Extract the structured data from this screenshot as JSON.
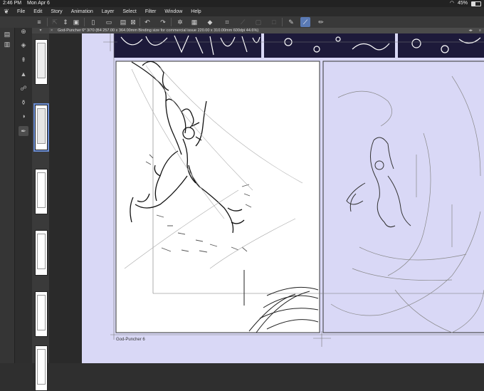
{
  "status": {
    "time": "2:46 PM",
    "date": "Mon Apr 6",
    "battery": "45%",
    "battery_level": 0.45
  },
  "menu": [
    "File",
    "Edit",
    "Story",
    "Animation",
    "Layer",
    "Select",
    "Filter",
    "Window",
    "Help"
  ],
  "tab": {
    "close": "×",
    "title": "God-Puncher 6* 3/70 (B4 257.00 x 364.00mm Binding size for commercial issue 220.00 x 310.00mm 600dpi 44.6%)"
  },
  "canvas": {
    "page_label": "God-Puncher 6"
  },
  "icons": {
    "logo": "app-logo",
    "menu": "hamburger-icon",
    "new": "new-file-icon",
    "open": "folder-icon",
    "save": "save-icon",
    "export": "export-icon",
    "undo": "undo-icon",
    "redo": "redo-icon",
    "pen": "pen-icon",
    "active": "curve-pen-icon"
  },
  "colors": {
    "accent": "#5a7ab5",
    "canvas_bg": "#d9d8f6",
    "ink": "#1d1a3a"
  }
}
